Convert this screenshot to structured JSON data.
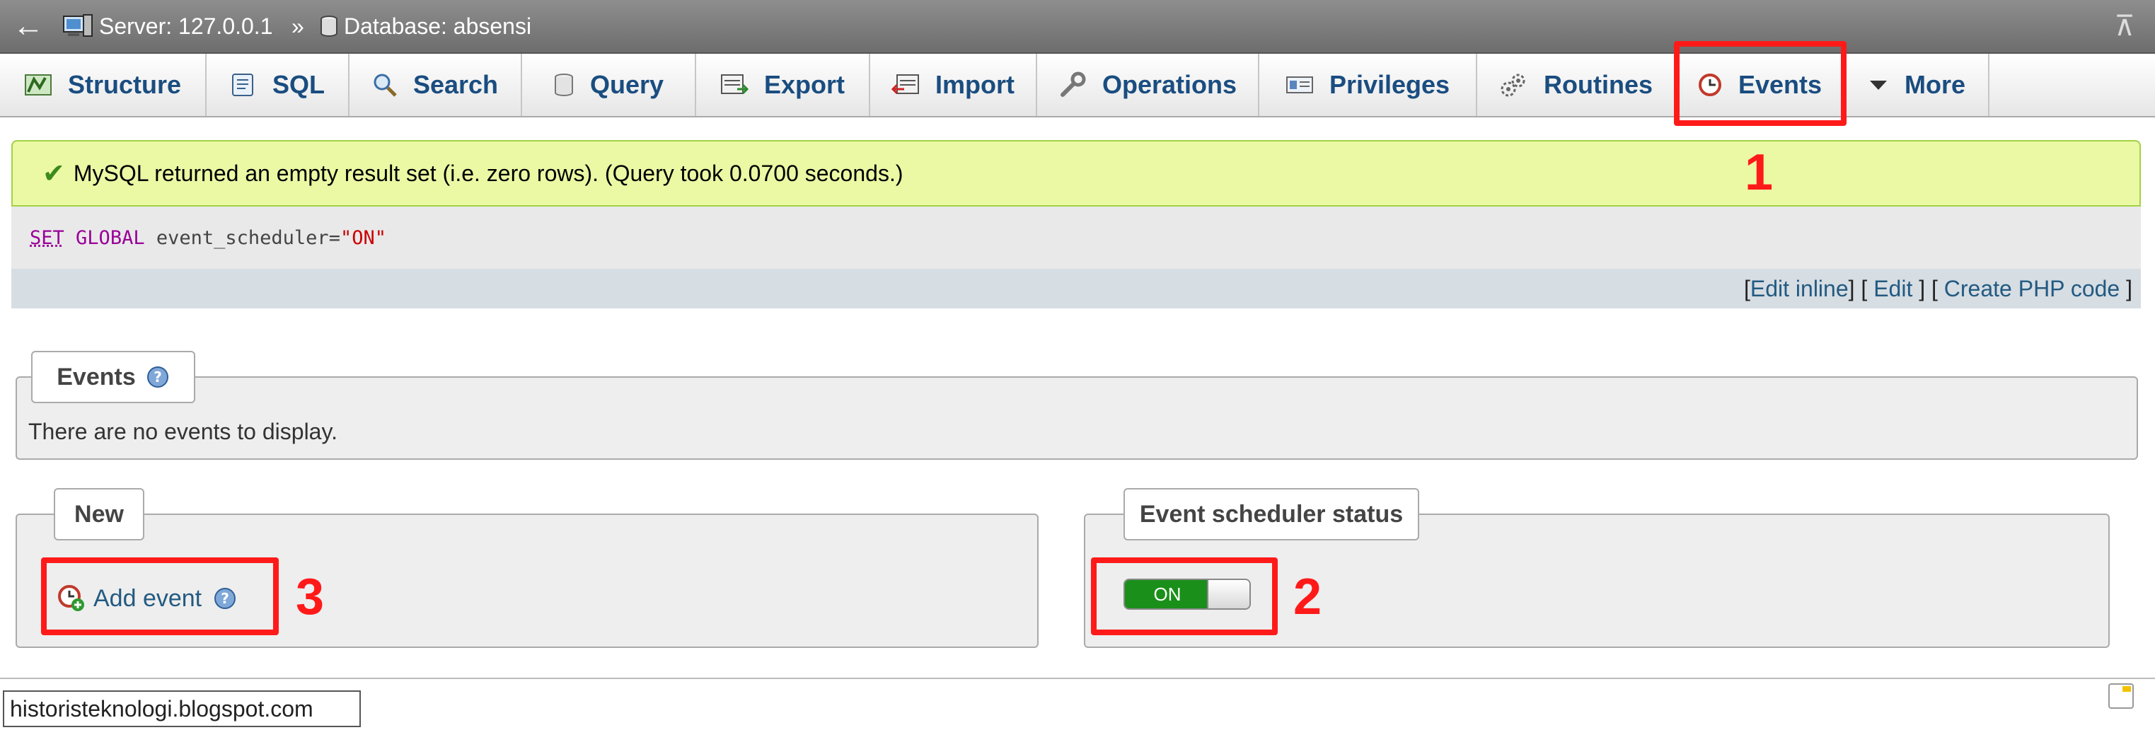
{
  "breadcrumb": {
    "server_label": "Server: 127.0.0.1",
    "separator": "»",
    "database_label": "Database: absensi"
  },
  "icons": {
    "back": "left-arrow-icon",
    "collapse": "collapse-up-icon"
  },
  "tabs": [
    {
      "label": "Structure",
      "icon": "structure-icon"
    },
    {
      "label": "SQL",
      "icon": "sql-icon"
    },
    {
      "label": "Search",
      "icon": "search-icon"
    },
    {
      "label": "Query",
      "icon": "query-icon"
    },
    {
      "label": "Export",
      "icon": "export-icon"
    },
    {
      "label": "Import",
      "icon": "import-icon"
    },
    {
      "label": "Operations",
      "icon": "wrench-icon"
    },
    {
      "label": "Privileges",
      "icon": "privileges-icon"
    },
    {
      "label": "Routines",
      "icon": "routines-icon"
    },
    {
      "label": "Events",
      "icon": "clock-icon"
    },
    {
      "label": "More",
      "icon": "caret-down-icon"
    }
  ],
  "message": {
    "text": "MySQL returned an empty result set (i.e. zero rows). (Query took 0.0700 seconds.)"
  },
  "sql": {
    "kw_set": "SET",
    "kw_global": "GLOBAL",
    "ident": "event_scheduler=",
    "value": "\"ON\""
  },
  "sql_links": {
    "open1": "[",
    "edit_inline": "Edit inline",
    "close_open": "] [",
    "edit": "Edit",
    "close_open2": "] [",
    "create_php": "Create PHP code",
    "close": "]"
  },
  "events_panel": {
    "legend": "Events",
    "empty_text": "There are no events to display."
  },
  "new_panel": {
    "legend": "New",
    "add_event": "Add event"
  },
  "scheduler_panel": {
    "legend": "Event scheduler status",
    "toggle_label": "ON"
  },
  "annotations": {
    "n1": "1",
    "n2": "2",
    "n3": "3"
  },
  "colors": {
    "highlight": "#ff1a1a",
    "tab_text": "#1a4d80",
    "success_bg": "#ebf8a4",
    "toggle_on": "#1a8f1a"
  },
  "watermark": "historisteknologi.blogspot.com"
}
